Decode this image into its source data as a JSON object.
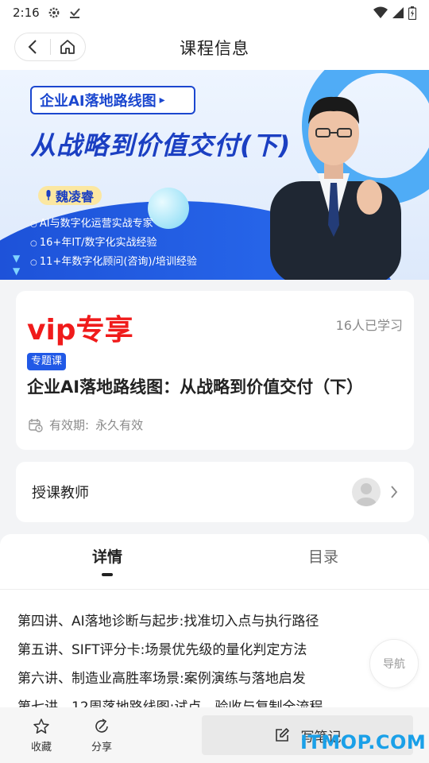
{
  "status_bar": {
    "time": "2:16",
    "icons": [
      "gear-icon",
      "download-check-icon",
      "wifi-icon",
      "signal-icon",
      "battery-icon"
    ]
  },
  "header": {
    "title": "课程信息",
    "back_icon": "back-icon",
    "home_icon": "home-icon"
  },
  "banner": {
    "tag": "企业AI落地路线图",
    "title": "从战略到价值交付(下)",
    "speaker": "魏凌睿",
    "points": [
      "AI与数字化运营实战专家",
      "16+年IT/数字化实战经验",
      "11+年数字化顾问(咨询)/培训经验"
    ]
  },
  "course": {
    "vip_label": "vip专享",
    "learners": "16人已学习",
    "type_badge": "专题课",
    "title": "企业AI落地路线图：从战略到价值交付（下）",
    "validity_label": "有效期:",
    "validity_value": "永久有效"
  },
  "teacher": {
    "label": "授课教师"
  },
  "tabs": [
    {
      "label": "详情",
      "active": true
    },
    {
      "label": "目录",
      "active": false
    }
  ],
  "lessons": [
    "第四讲、AI落地诊断与起步:找准切入点与执行路径",
    "第五讲、SIFT评分卡:场景优先级的量化判定方法",
    "第六讲、制造业高胜率场景:案例演练与落地启发",
    "第七讲、12周落地路线图:试点、验收与复制全流程"
  ],
  "float_nav": "导航",
  "bottom_bar": {
    "favorite": "收藏",
    "share": "分享",
    "write_note": "写笔记"
  },
  "watermark": "ITMOP.COM",
  "colors": {
    "vip_red": "#f01b1b",
    "badge_blue": "#2159e6",
    "banner_blue": "#1b3fc2",
    "watermark": "#1aa0e8"
  }
}
